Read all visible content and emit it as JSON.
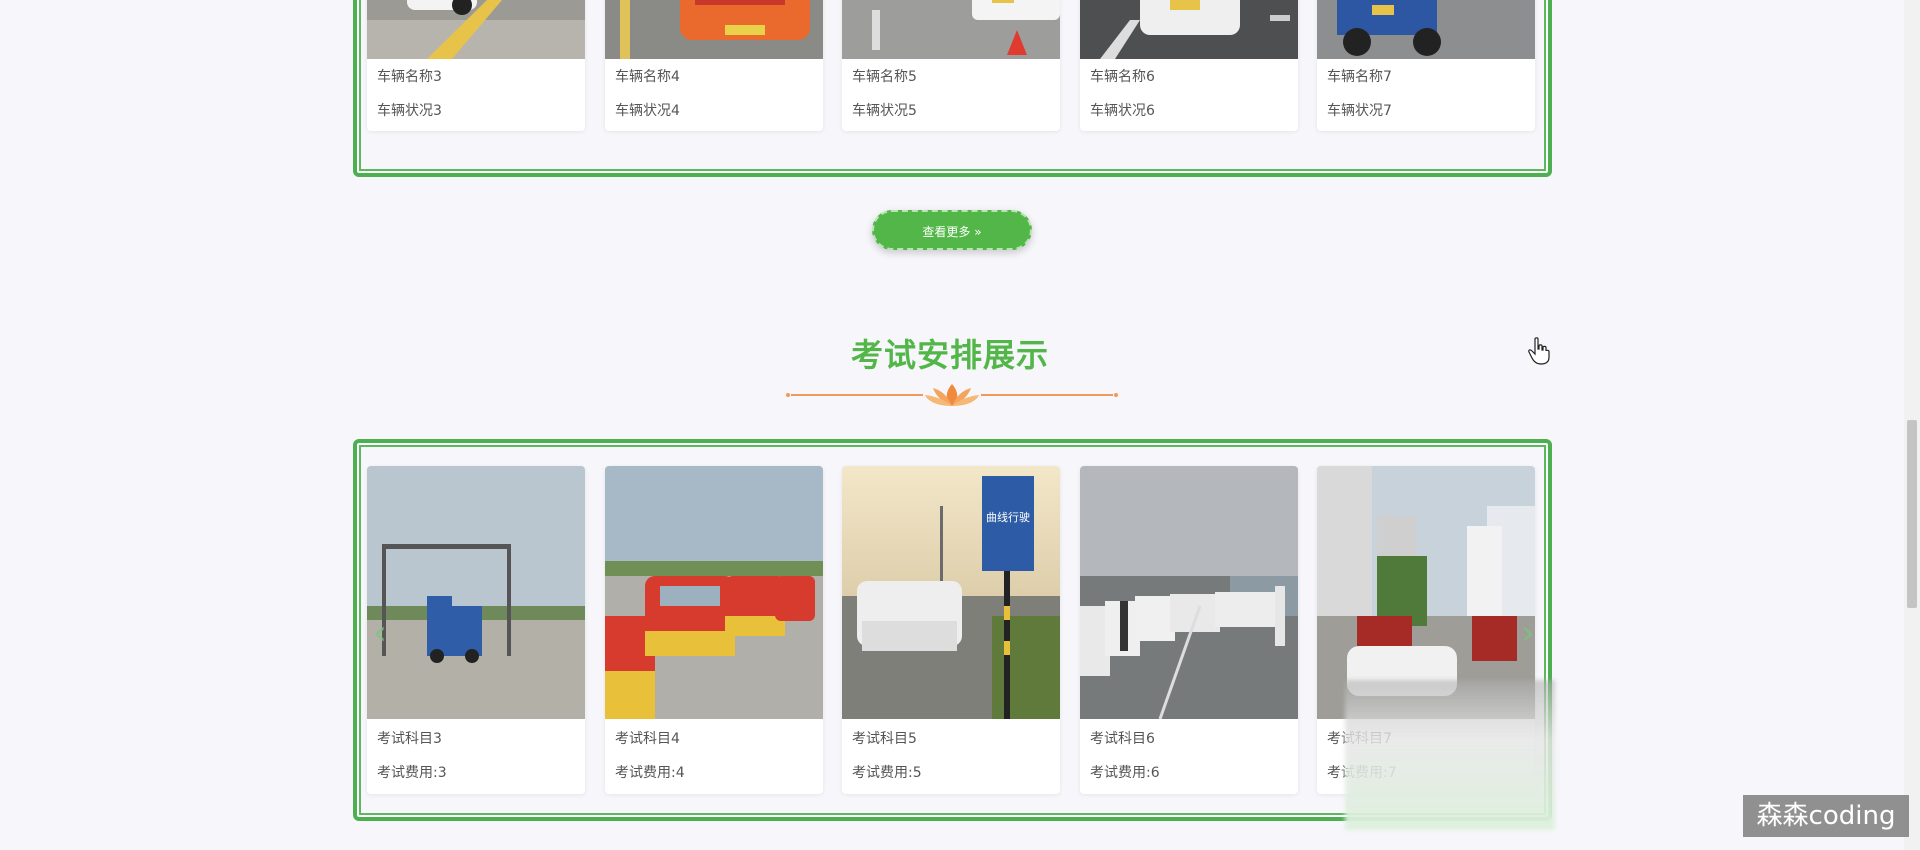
{
  "vehicles": {
    "cards": [
      {
        "name": "车辆名称3",
        "status": "车辆状况3"
      },
      {
        "name": "车辆名称4",
        "status": "车辆状况4"
      },
      {
        "name": "车辆名称5",
        "status": "车辆状况5"
      },
      {
        "name": "车辆名称6",
        "status": "车辆状况6"
      },
      {
        "name": "车辆名称7",
        "status": "车辆状况7"
      }
    ],
    "more_label": "查看更多 »"
  },
  "exams": {
    "title": "考试安排展示",
    "cards": [
      {
        "subject": "考试科目3",
        "fee": "考试费用:3"
      },
      {
        "subject": "考试科目4",
        "fee": "考试费用:4"
      },
      {
        "subject": "考试科目5",
        "fee": "考试费用:5"
      },
      {
        "subject": "考试科目6",
        "fee": "考试费用:6"
      },
      {
        "subject": "考试科目7",
        "fee": "考试费用:7"
      }
    ],
    "sign_text": "曲线行驶"
  },
  "watermark": "森森coding",
  "colors": {
    "accent": "#52b748",
    "frame": "#4caf50",
    "divider": "#f09a59"
  }
}
